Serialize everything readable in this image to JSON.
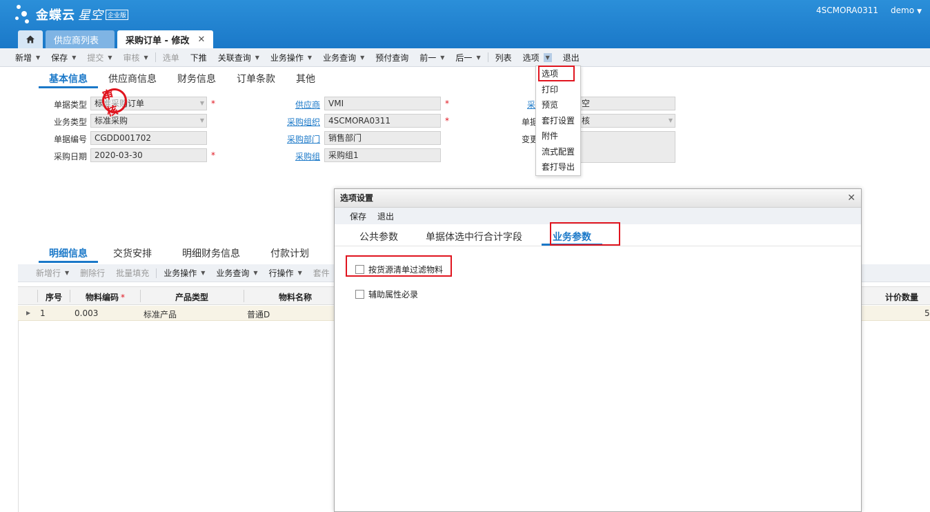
{
  "header": {
    "brand": "金蝶云",
    "brand_sub": "星空",
    "edition_badge": "企业版",
    "account": "4SCMORA0311",
    "user": "demo"
  },
  "tabs": [
    {
      "label": "供应商列表"
    },
    {
      "label": "采购订单 - 修改"
    }
  ],
  "toolbar": {
    "items": [
      "新增",
      "保存",
      "提交",
      "审核",
      "选单",
      "下推",
      "关联查询",
      "业务操作",
      "业务查询",
      "预付查询",
      "前一",
      "后一",
      "列表",
      "选项",
      "退出"
    ]
  },
  "options_menu": [
    "选项",
    "打印",
    "预览",
    "套打设置",
    "附件",
    "流式配置",
    "套打导出"
  ],
  "section_tabs": [
    "基本信息",
    "供应商信息",
    "财务信息",
    "订单条款",
    "其他"
  ],
  "form": {
    "doc_type_label": "单据类型",
    "doc_type_value": "标准采购订单",
    "biz_type_label": "业务类型",
    "biz_type_value": "标准采购",
    "doc_no_label": "单据编号",
    "doc_no_value": "CGDD001702",
    "date_label": "采购日期",
    "date_value": "2020-03-30",
    "supplier_label": "供应商",
    "supplier_value": "VMI",
    "org_label": "采购组织",
    "org_value": "4SCMORA0311",
    "dept_label": "采购部门",
    "dept_value": "销售部门",
    "group_label": "采购组",
    "group_value": "采购组1",
    "col3_label1": "采",
    "col3_value1": "空",
    "col3_label2": "单据",
    "col3_value2": "核",
    "col3_label3": "变更"
  },
  "stamp": "审核",
  "detail_tabs": [
    "明细信息",
    "交货安排",
    "明细财务信息",
    "付款计划"
  ],
  "detail_toolbar": [
    "新增行",
    "删除行",
    "批量填充",
    "业务操作",
    "业务查询",
    "行操作",
    "套件"
  ],
  "grid": {
    "headers": [
      "序号",
      "物料编码",
      "产品类型",
      "物料名称",
      "计价数量"
    ],
    "rows": [
      {
        "seq": "1",
        "code": "0.003",
        "type": "标准产品",
        "name": "普通D",
        "qty": "5"
      }
    ]
  },
  "modal": {
    "title": "选项设置",
    "toolbar": [
      "保存",
      "退出"
    ],
    "tabs": [
      "公共参数",
      "单据体选中行合计字段",
      "业务参数"
    ],
    "options": [
      "按货源清单过滤物料",
      "辅助属性必录"
    ]
  },
  "colors": {
    "header_blue": "#1a78c8",
    "highlight_red": "#e0141e"
  }
}
